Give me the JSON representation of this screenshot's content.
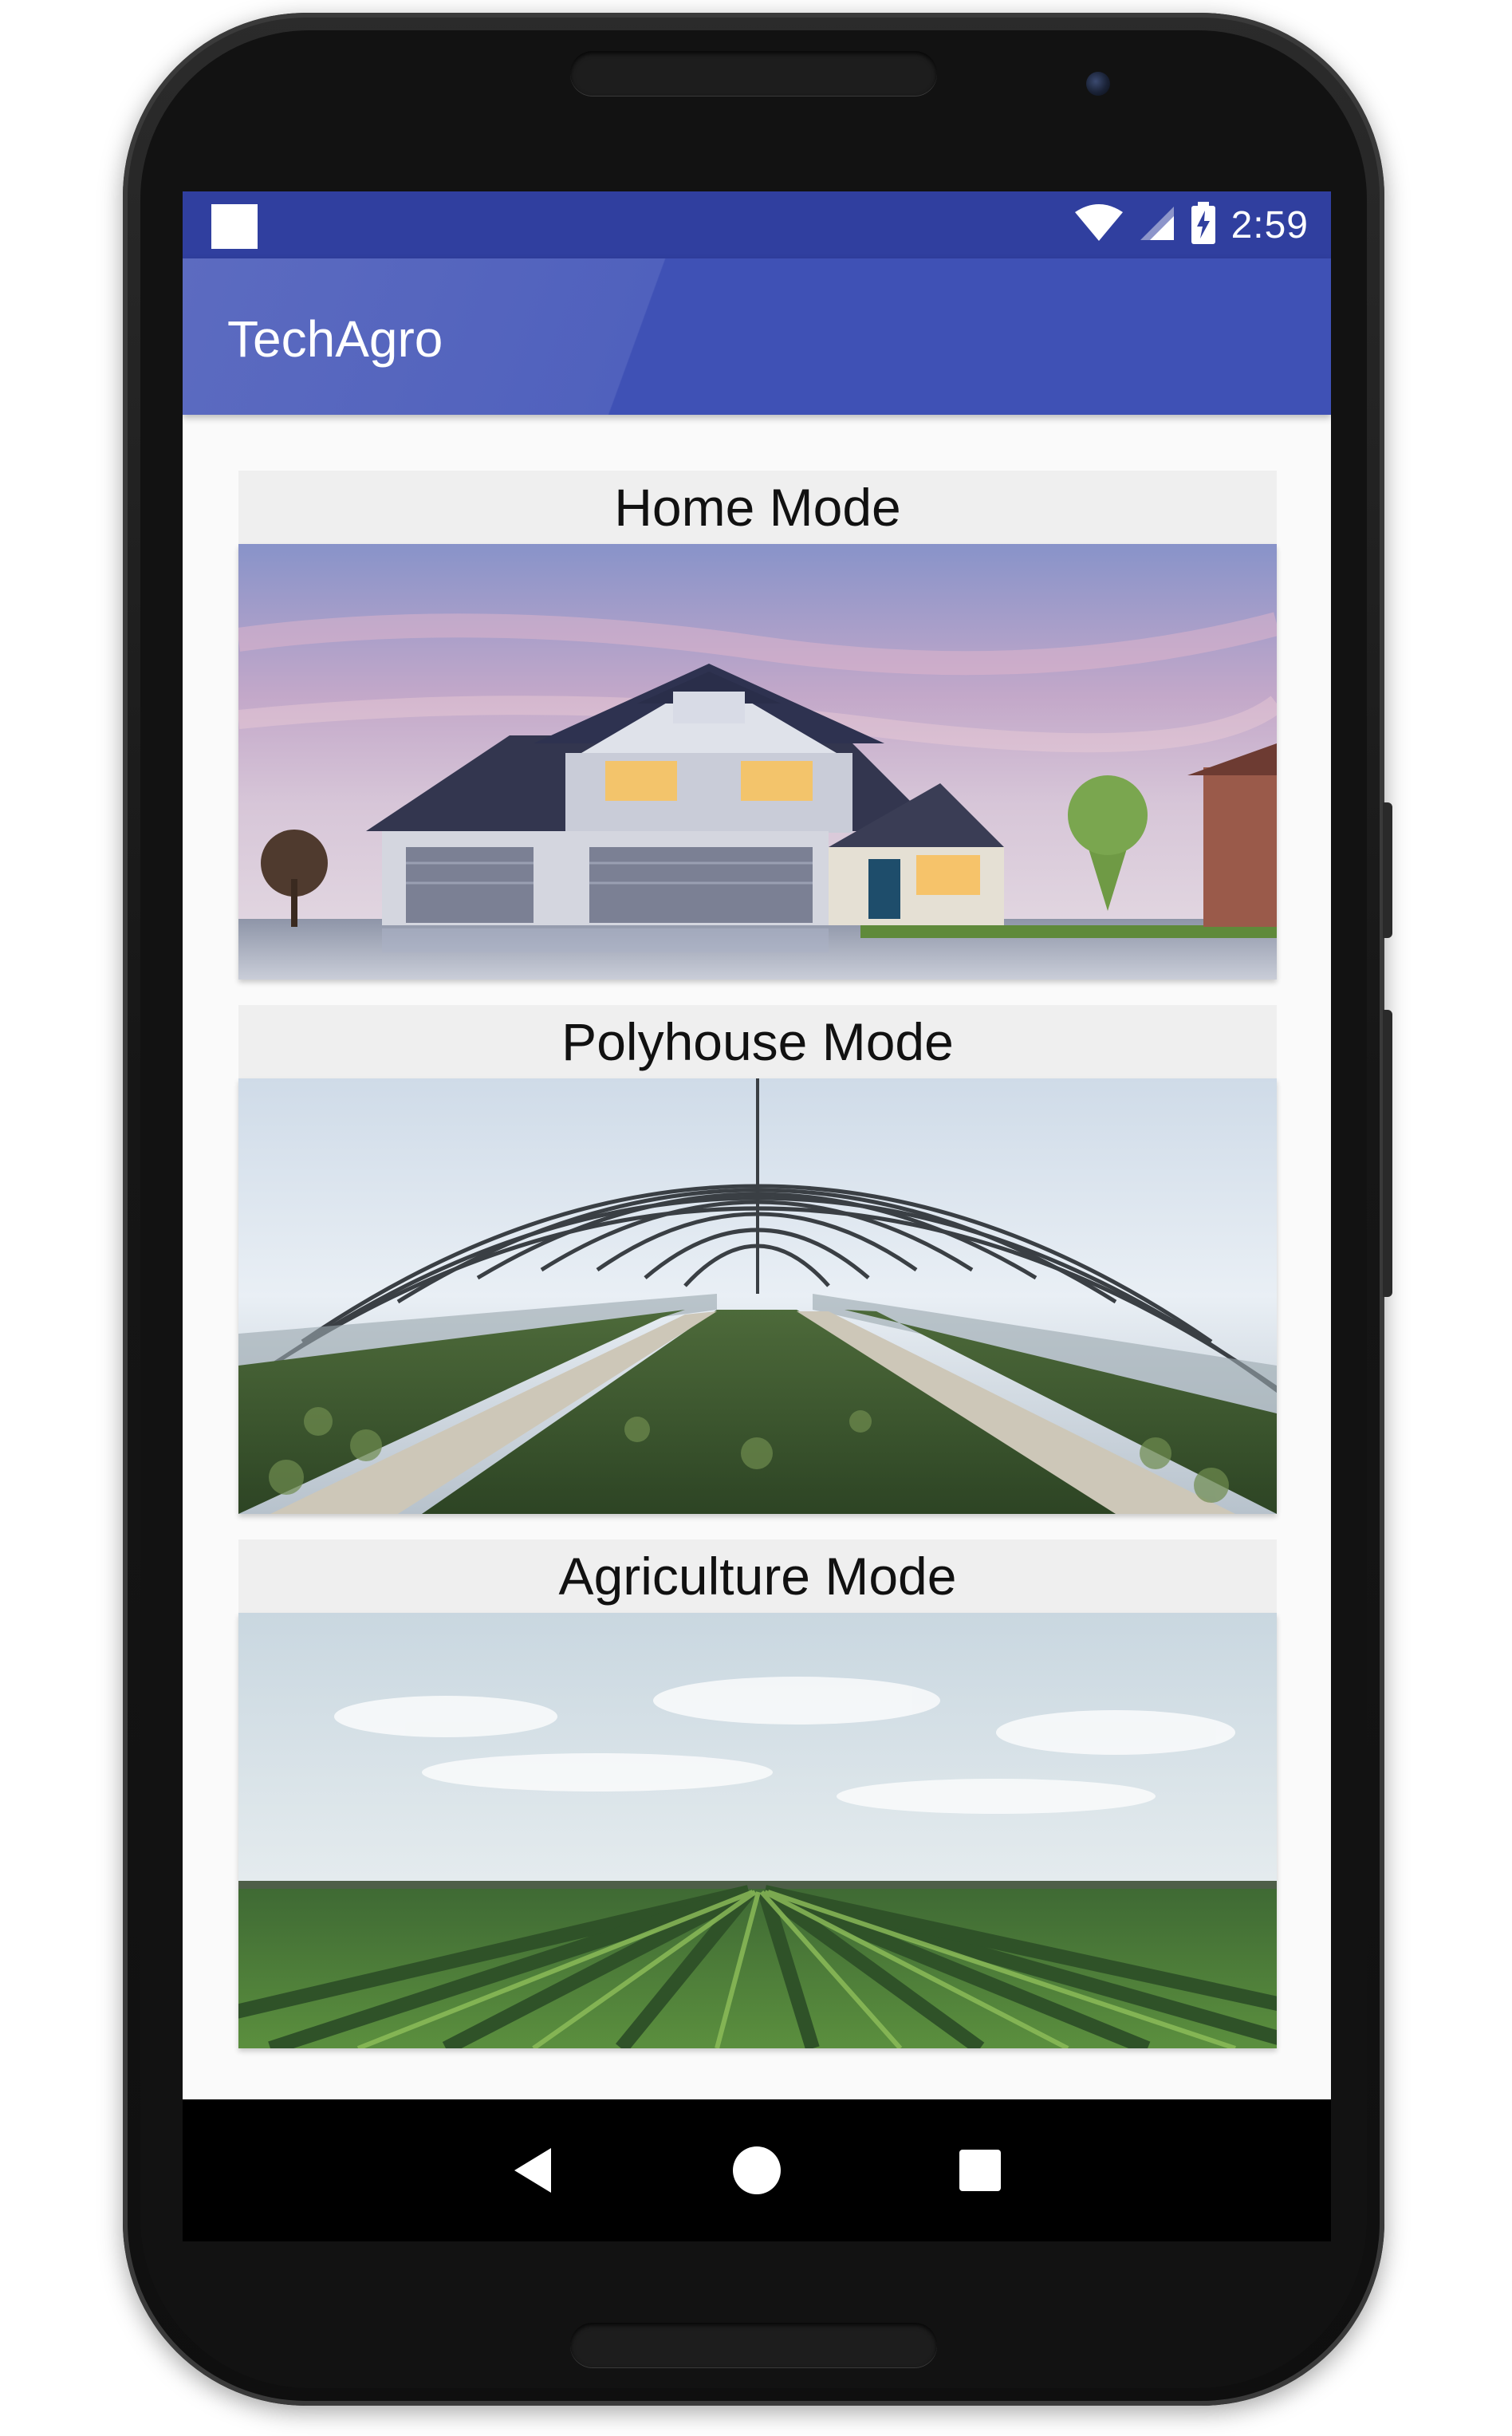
{
  "status_bar": {
    "time": "2:59",
    "icons": [
      "notification-square-icon",
      "wifi-icon",
      "cell-signal-icon",
      "battery-charging-icon"
    ]
  },
  "app_bar": {
    "title": "TechAgro",
    "color": "#3f51b5",
    "status_color": "#303f9f"
  },
  "modes": [
    {
      "label": "Home Mode",
      "image": "house-photo"
    },
    {
      "label": "Polyhouse Mode",
      "image": "polyhouse-greenhouse-photo"
    },
    {
      "label": "Agriculture Mode",
      "image": "vineyard-field-photo"
    }
  ],
  "nav_bar": {
    "buttons": [
      "back-icon",
      "home-icon",
      "recents-icon"
    ]
  }
}
